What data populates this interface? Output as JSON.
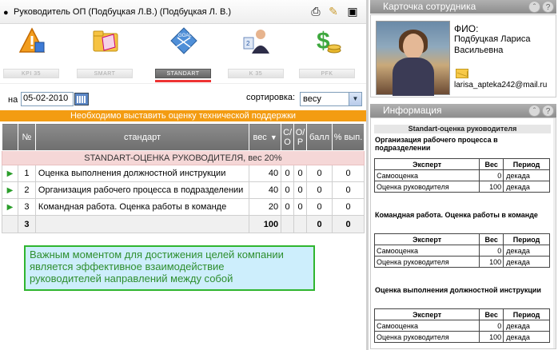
{
  "header": {
    "title": "Руководитель ОП (Подбуцкая Л.В.)  (Подбуцкая Л. В.)"
  },
  "modules": [
    {
      "label": "KPI 35",
      "icon": "kpi-warning-icon"
    },
    {
      "label": "SMART",
      "icon": "smart-folder-icon"
    },
    {
      "label": "STANDART",
      "icon": "standart-goal-icon",
      "active": true
    },
    {
      "label": "K 35",
      "icon": "k-person-icon"
    },
    {
      "label": "PFK",
      "icon": "pfk-dollar-icon"
    }
  ],
  "controls": {
    "date_label": "на",
    "date_value": "05-02-2010",
    "sort_label": "сортировка:",
    "sort_value": "весу"
  },
  "notice": "Необходимо выставить оценку технической поддержки",
  "table": {
    "headers": {
      "num": "№",
      "standard": "стандарт",
      "weight": "вес",
      "co": "С/О",
      "op": "О/Р",
      "score": "балл",
      "pct": "% вып."
    },
    "group": "STANDART-ОЦЕНКА РУКОВОДИТЕЛЯ, вес 20%",
    "rows": [
      {
        "num": "1",
        "name": "Оценка выполнения должностной инструкции",
        "weight": "40",
        "co": "0",
        "op": "0",
        "score": "0",
        "pct": "0"
      },
      {
        "num": "2",
        "name": "Организация рабочего процесса в подразделении",
        "weight": "40",
        "co": "0",
        "op": "0",
        "score": "0",
        "pct": "0"
      },
      {
        "num": "3",
        "name": "Командная работа. Оценка работы в команде",
        "weight": "20",
        "co": "0",
        "op": "0",
        "score": "0",
        "pct": "0"
      }
    ],
    "total": {
      "num": "3",
      "weight": "100",
      "score": "0",
      "pct": "0"
    }
  },
  "tip": [
    "Важным моментом для достижения  целей компании",
    "является  эффективное взаимодействие",
    "руководителей направлений между собой"
  ],
  "card": {
    "title": "Карточка сотрудника",
    "fio_label": "ФИО:",
    "name_line1": "Подбуцкая Лариса",
    "name_line2": "Васильевна",
    "email": "larisa_apteka242@mail.ru"
  },
  "info": {
    "title": "Информация",
    "heading": "Standart-оценка руководителя",
    "col_expert": "Эксперт",
    "col_weight": "Вес",
    "col_period": "Период",
    "sections": [
      {
        "title": "Организация рабочего процесса в подразделении",
        "rows": [
          {
            "expert": "Самооценка",
            "weight": "0",
            "period": "декада"
          },
          {
            "expert": "Оценка руководителя",
            "weight": "100",
            "period": "декада"
          }
        ]
      },
      {
        "title": "Командная работа. Оценка работы в команде",
        "rows": [
          {
            "expert": "Самооценка",
            "weight": "0",
            "period": "декада"
          },
          {
            "expert": "Оценка руководителя",
            "weight": "100",
            "period": "декада"
          }
        ]
      },
      {
        "title": "Оценка выполнения должностной инструкции",
        "rows": [
          {
            "expert": "Самооценка",
            "weight": "0",
            "period": "декада"
          },
          {
            "expert": "Оценка руководителя",
            "weight": "100",
            "period": "декада"
          }
        ]
      }
    ]
  },
  "colors": {
    "notice_bg": "#f39c12",
    "header_gray": "#8d8d8d",
    "group_row": "#f5d7d7",
    "tip_border": "#2fb52f",
    "tip_bg": "#cdeefc"
  }
}
